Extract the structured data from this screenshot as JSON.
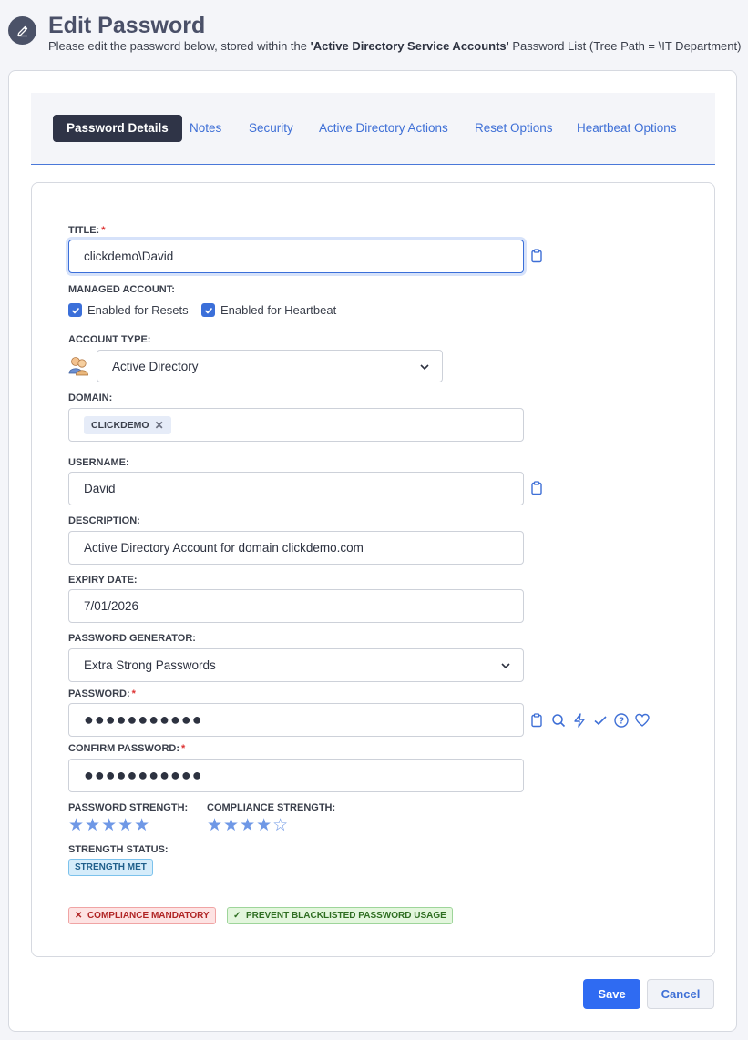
{
  "header": {
    "title": "Edit Password",
    "subtitle_pre": "Please edit the password below, stored within the ",
    "subtitle_list": "'Active Directory Service Accounts'",
    "subtitle_post": " Password List (Tree Path = \\IT Department)"
  },
  "tabs": [
    {
      "label": "Password Details",
      "active": true
    },
    {
      "label": "Notes"
    },
    {
      "label": "Security"
    },
    {
      "label": "Active Directory Actions"
    },
    {
      "label": "Reset Options"
    },
    {
      "label": "Heartbeat Options"
    }
  ],
  "form": {
    "title_label": "TITLE:",
    "title_value": "clickdemo\\David",
    "managed_label": "MANAGED ACCOUNT:",
    "resets_label": "Enabled for Resets",
    "heartbeat_label": "Enabled for Heartbeat",
    "account_type_label": "ACCOUNT TYPE:",
    "account_type_value": "Active Directory",
    "domain_label": "DOMAIN:",
    "domain_chip": "CLICKDEMO",
    "username_label": "USERNAME:",
    "username_value": "David",
    "description_label": "DESCRIPTION:",
    "description_value": "Active Directory Account for domain clickdemo.com",
    "expiry_label": "EXPIRY DATE:",
    "expiry_value": "7/01/2026",
    "generator_label": "PASSWORD GENERATOR:",
    "generator_value": "Extra Strong Passwords",
    "password_label": "PASSWORD:",
    "password_value": "●●●●●●●●●●●",
    "confirm_label": "CONFIRM PASSWORD:",
    "confirm_value": "●●●●●●●●●●●",
    "pw_strength_label": "PASSWORD STRENGTH:",
    "pw_strength_stars": "★★★★★",
    "pw_strength_rating": 5,
    "compliance_label": "COMPLIANCE STRENGTH:",
    "compliance_stars": "★★★★☆",
    "compliance_rating": 4,
    "status_label": "STRENGTH STATUS:",
    "status_badge": "STRENGTH MET",
    "compliance_badge": "COMPLIANCE MANDATORY",
    "blacklist_badge": "PREVENT BLACKLISTED PASSWORD USAGE"
  },
  "buttons": {
    "save": "Save",
    "cancel": "Cancel"
  },
  "colors": {
    "accent": "#2f6bf2",
    "tab_active_bg": "#2f3447",
    "link": "#3e6fd6",
    "star": "#6f98e6"
  }
}
